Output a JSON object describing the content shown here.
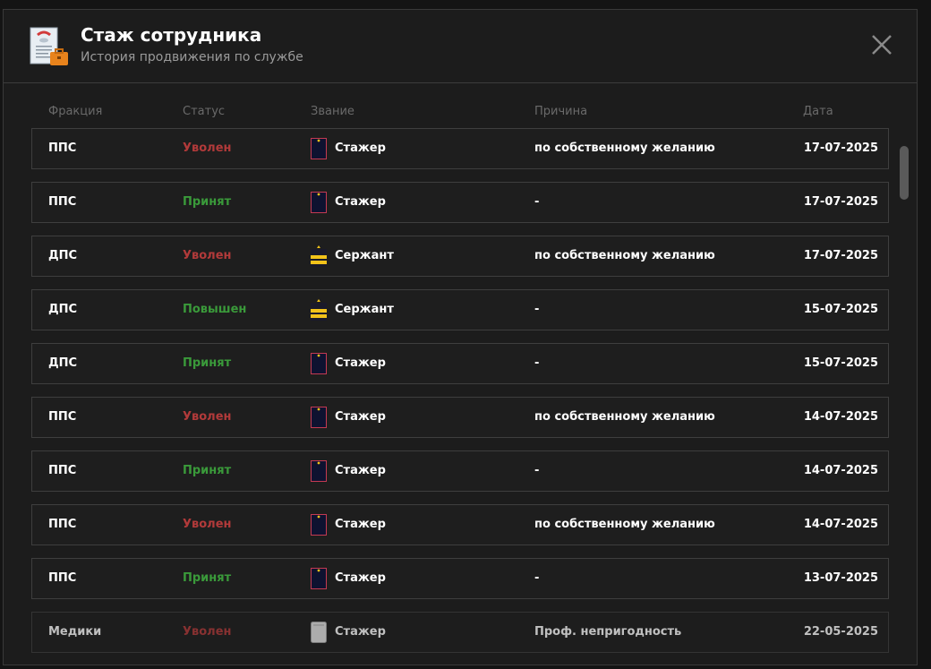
{
  "header": {
    "title": "Стаж сотрудника",
    "subtitle": "История продвижения по службе",
    "icon": "document-briefcase-icon",
    "close_icon": "close-icon"
  },
  "columns": {
    "faction": "Фракция",
    "status": "Статус",
    "rank": "Звание",
    "reason": "Причина",
    "date": "Дата"
  },
  "colors": {
    "dismissed": "#b23a3a",
    "hired": "#3a9a3a",
    "background": "#1c1c1c"
  },
  "rows": [
    {
      "faction": "ППС",
      "status": "Уволен",
      "status_type": "red",
      "rank": "Стажер",
      "rank_icon": "intern-badge-icon",
      "reason": "по собственному желанию",
      "date": "17-07-2025"
    },
    {
      "faction": "ППС",
      "status": "Принят",
      "status_type": "green",
      "rank": "Стажер",
      "rank_icon": "intern-badge-icon",
      "reason": "-",
      "date": "17-07-2025"
    },
    {
      "faction": "ДПС",
      "status": "Уволен",
      "status_type": "red",
      "rank": "Сержант",
      "rank_icon": "sergeant-badge-icon",
      "reason": "по собственному желанию",
      "date": "17-07-2025"
    },
    {
      "faction": "ДПС",
      "status": "Повышен",
      "status_type": "green",
      "rank": "Сержант",
      "rank_icon": "sergeant-badge-icon",
      "reason": "-",
      "date": "15-07-2025"
    },
    {
      "faction": "ДПС",
      "status": "Принят",
      "status_type": "green",
      "rank": "Стажер",
      "rank_icon": "intern-badge-icon",
      "reason": "-",
      "date": "15-07-2025"
    },
    {
      "faction": "ППС",
      "status": "Уволен",
      "status_type": "red",
      "rank": "Стажер",
      "rank_icon": "intern-badge-icon",
      "reason": "по собственному желанию",
      "date": "14-07-2025"
    },
    {
      "faction": "ППС",
      "status": "Принят",
      "status_type": "green",
      "rank": "Стажер",
      "rank_icon": "intern-badge-icon",
      "reason": "-",
      "date": "14-07-2025"
    },
    {
      "faction": "ППС",
      "status": "Уволен",
      "status_type": "red",
      "rank": "Стажер",
      "rank_icon": "intern-badge-icon",
      "reason": "по собственному желанию",
      "date": "14-07-2025"
    },
    {
      "faction": "ППС",
      "status": "Принят",
      "status_type": "green",
      "rank": "Стажер",
      "rank_icon": "intern-badge-icon",
      "reason": "-",
      "date": "13-07-2025"
    },
    {
      "faction": "Медики",
      "status": "Уволен",
      "status_type": "red",
      "rank": "Стажер",
      "rank_icon": "medic-intern-badge-icon",
      "reason": "Проф. непригодность",
      "date": "22-05-2025"
    }
  ]
}
